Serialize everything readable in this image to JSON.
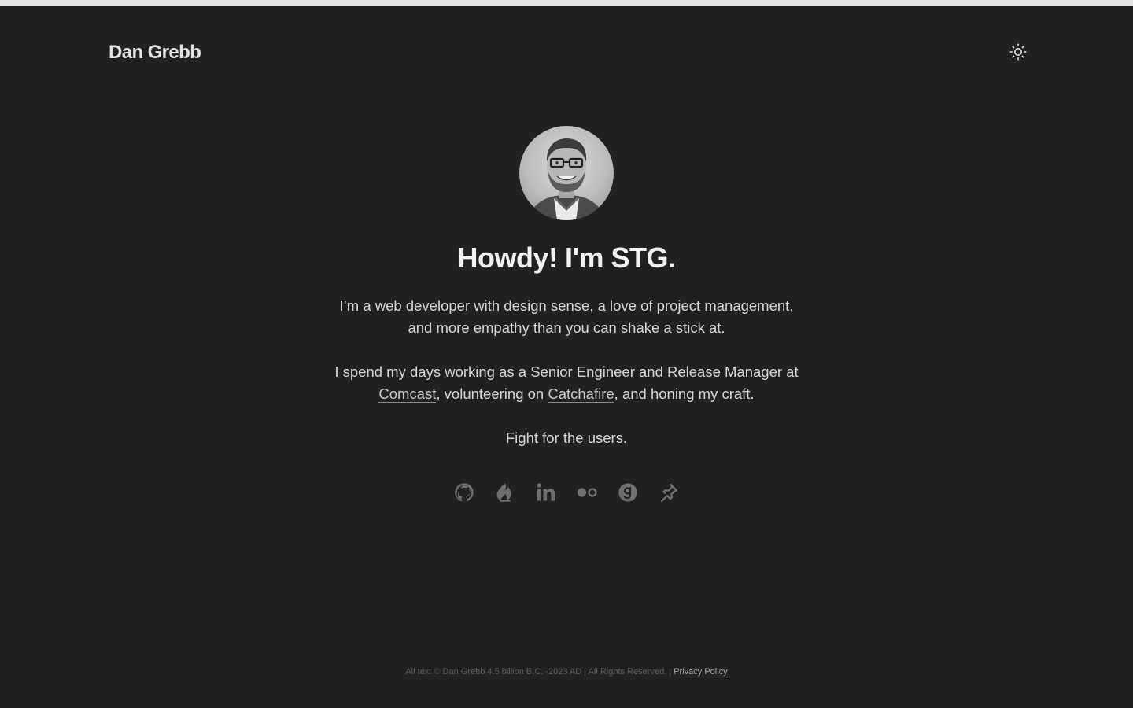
{
  "header": {
    "site_title": "Dan Grebb",
    "theme_toggle_icon": "sun-icon"
  },
  "hero": {
    "avatar_icon": "profile-photo",
    "headline": "Howdy! I'm STG.",
    "intro": "I’m a web developer with design sense, a love of project management, and more empathy than you can shake a stick at.",
    "work_prefix": "I spend my days working as a Senior Engineer and Release Manager at ",
    "work_link_1": "Comcast",
    "work_middle": ", volunteering on ",
    "work_link_2": "Catchafire",
    "work_suffix": ", and honing my craft.",
    "motto": "Fight for the users."
  },
  "social": [
    {
      "icon": "github-icon"
    },
    {
      "icon": "catchafire-icon"
    },
    {
      "icon": "linkedin-icon"
    },
    {
      "icon": "flickr-icon"
    },
    {
      "icon": "goodreads-icon"
    },
    {
      "icon": "pin-icon"
    }
  ],
  "footer": {
    "copyright": "All text © Dan Grebb 4.5 billion B.C. -2023 AD | All Rights Reserved. | ",
    "privacy_link": "Privacy Policy"
  },
  "colors": {
    "background": "#212123",
    "text": "#e2e2e2",
    "icon": "#6f6f71",
    "footer_text": "#5e5e60"
  }
}
